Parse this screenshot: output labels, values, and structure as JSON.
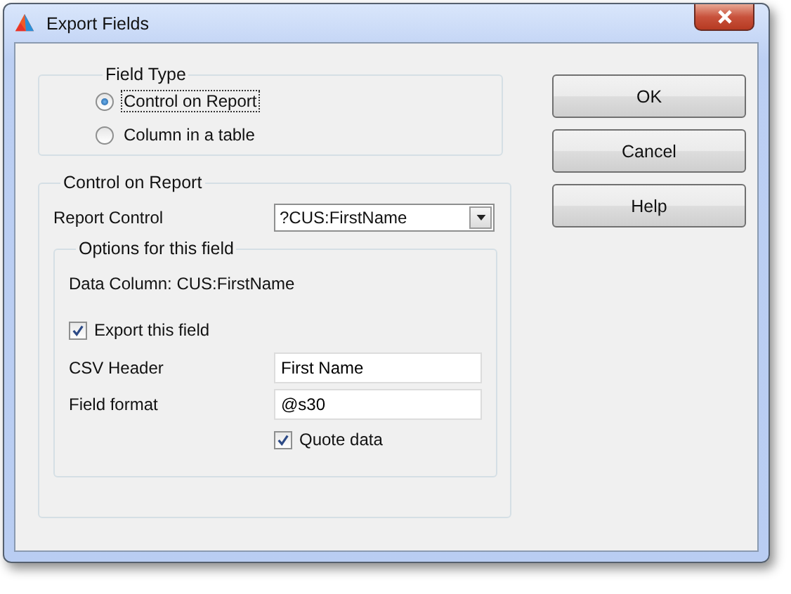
{
  "window": {
    "title": "Export Fields"
  },
  "field_type": {
    "label": "Field Type",
    "options": [
      {
        "label": "Control on Report",
        "selected": true
      },
      {
        "label": "Column in a table",
        "selected": false
      }
    ]
  },
  "control_group": {
    "label": "Control on Report",
    "report_control": {
      "label": "Report Control",
      "value": "?CUS:FirstName"
    },
    "options_group": {
      "label": "Options for this field",
      "data_column": "Data Column: CUS:FirstName",
      "export_field": {
        "label": "Export this field",
        "checked": true
      },
      "csv_header": {
        "label": "CSV Header",
        "value": "First Name"
      },
      "field_format": {
        "label": "Field format",
        "value": "@s30"
      },
      "quote_data": {
        "label": "Quote data",
        "checked": true
      }
    }
  },
  "buttons": [
    "OK",
    "Cancel",
    "Help"
  ]
}
